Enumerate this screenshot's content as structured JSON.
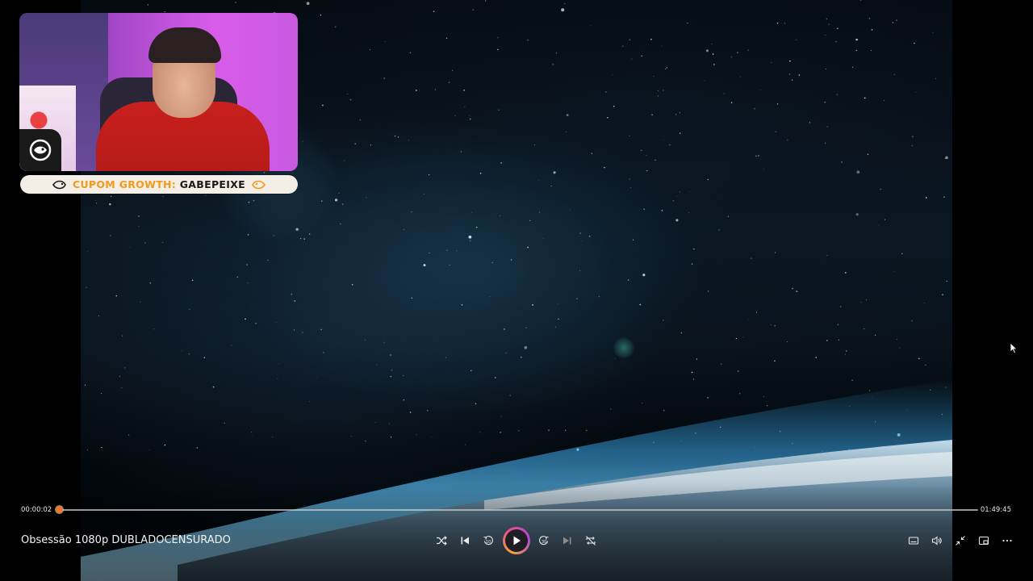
{
  "overlay": {
    "coupon_label": "CUPOM GROWTH:",
    "coupon_code": "GABEPEIXE"
  },
  "player": {
    "elapsed": "00:00:02",
    "total": "01:49:45",
    "progress_fraction": 0.0003,
    "title": "Obsessão 1080p DUBLADOCENSURADO"
  },
  "icons": {
    "shuffle": "shuffle-icon",
    "previous": "skip-previous-icon",
    "rewind": "rewind-10-icon",
    "play": "play-icon",
    "forward": "forward-30-icon",
    "next": "skip-next-icon",
    "repeat": "repeat-off-icon",
    "captions": "captions-icon",
    "volume": "volume-icon",
    "fullscreen": "exit-fullscreen-icon",
    "miniplayer": "miniplayer-icon",
    "more": "more-icon"
  },
  "colors": {
    "accent": "#f07a2a",
    "coupon_label": "#f29a1e"
  }
}
